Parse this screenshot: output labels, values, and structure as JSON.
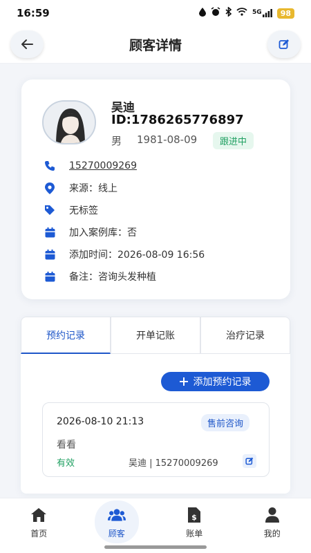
{
  "status_bar": {
    "time": "16:59",
    "network": "5G",
    "battery": "98"
  },
  "header": {
    "title": "顾客详情",
    "back_icon": "arrow-left-icon",
    "edit_icon": "edit-icon"
  },
  "profile": {
    "name": "吴迪",
    "id_text": "ID:1786265776897",
    "gender": "男",
    "birthday": "1981-08-09",
    "status": "跟进中",
    "phone": "15270009269",
    "source": "来源：线上",
    "tags": "无标签",
    "case_library": "加入案例库：否",
    "added_time": "添加时间：2026-08-09 16:56",
    "remark": "备注：咨询头发种植"
  },
  "tabs": [
    {
      "label": "预约记录",
      "active": true
    },
    {
      "label": "开单记账",
      "active": false
    },
    {
      "label": "治疗记录",
      "active": false
    }
  ],
  "actions": {
    "add_appointment": "添加预约记录"
  },
  "records": [
    {
      "datetime": "2026-08-10 21:13",
      "type": "售前咨询",
      "note": "看看",
      "validity": "有效",
      "staff": "吴迪 | 15270009269"
    }
  ],
  "bottom_nav": [
    {
      "label": "首页",
      "icon": "home-icon",
      "active": false
    },
    {
      "label": "顾客",
      "icon": "customers-icon",
      "active": true
    },
    {
      "label": "账单",
      "icon": "bill-icon",
      "active": false
    },
    {
      "label": "我的",
      "icon": "profile-icon",
      "active": false
    }
  ],
  "colors": {
    "primary": "#1d5ad4",
    "success": "#20a062",
    "background": "#f3f5f9"
  }
}
